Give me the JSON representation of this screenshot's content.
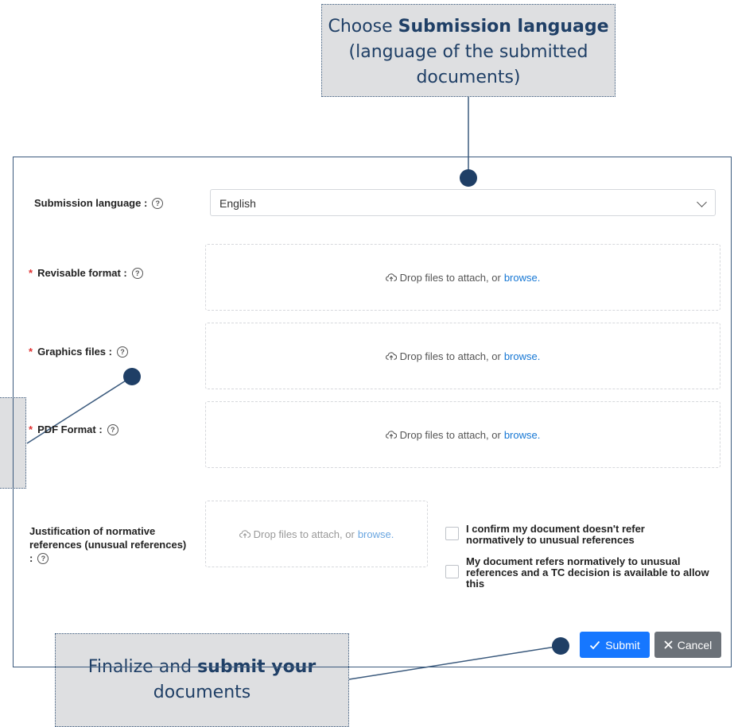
{
  "callouts": {
    "top": {
      "prefix": "Choose ",
      "bold": "Submission language",
      "line2": "(language of the submitted",
      "line3": "documents)"
    },
    "bottom": {
      "prefix": "Finalize and ",
      "bold": "submit your",
      "line2": "documents"
    }
  },
  "form": {
    "submission_language": {
      "label": "Submission language :",
      "value": "English"
    },
    "revisable_format": {
      "label": "Revisable format :"
    },
    "graphics_files": {
      "label": "Graphics files :"
    },
    "pdf_format": {
      "label": "PDF Format :"
    },
    "justification": {
      "label_line1": "Justification of normative",
      "label_line2": "references (unusual references)",
      "label_line3": ":"
    },
    "drop_text": "Drop files to attach, or",
    "browse_text": "browse.",
    "checkbox1": {
      "line1": "I confirm my document doesn't refer",
      "line2": "normatively to unusual references"
    },
    "checkbox2": {
      "line1": "My document refers normatively to unusual",
      "line2": "references and a TC decision is available to allow",
      "line3": "this"
    }
  },
  "buttons": {
    "submit": "Submit",
    "cancel": "Cancel"
  },
  "icons": {
    "help": "question-circle-icon",
    "upload": "cloud-upload-icon",
    "check": "check-icon",
    "close": "close-icon"
  },
  "colors": {
    "primary": "#1677ff",
    "callout_text": "#1f3f66",
    "callout_bg": "#dedfe1",
    "required": "#e03131"
  }
}
